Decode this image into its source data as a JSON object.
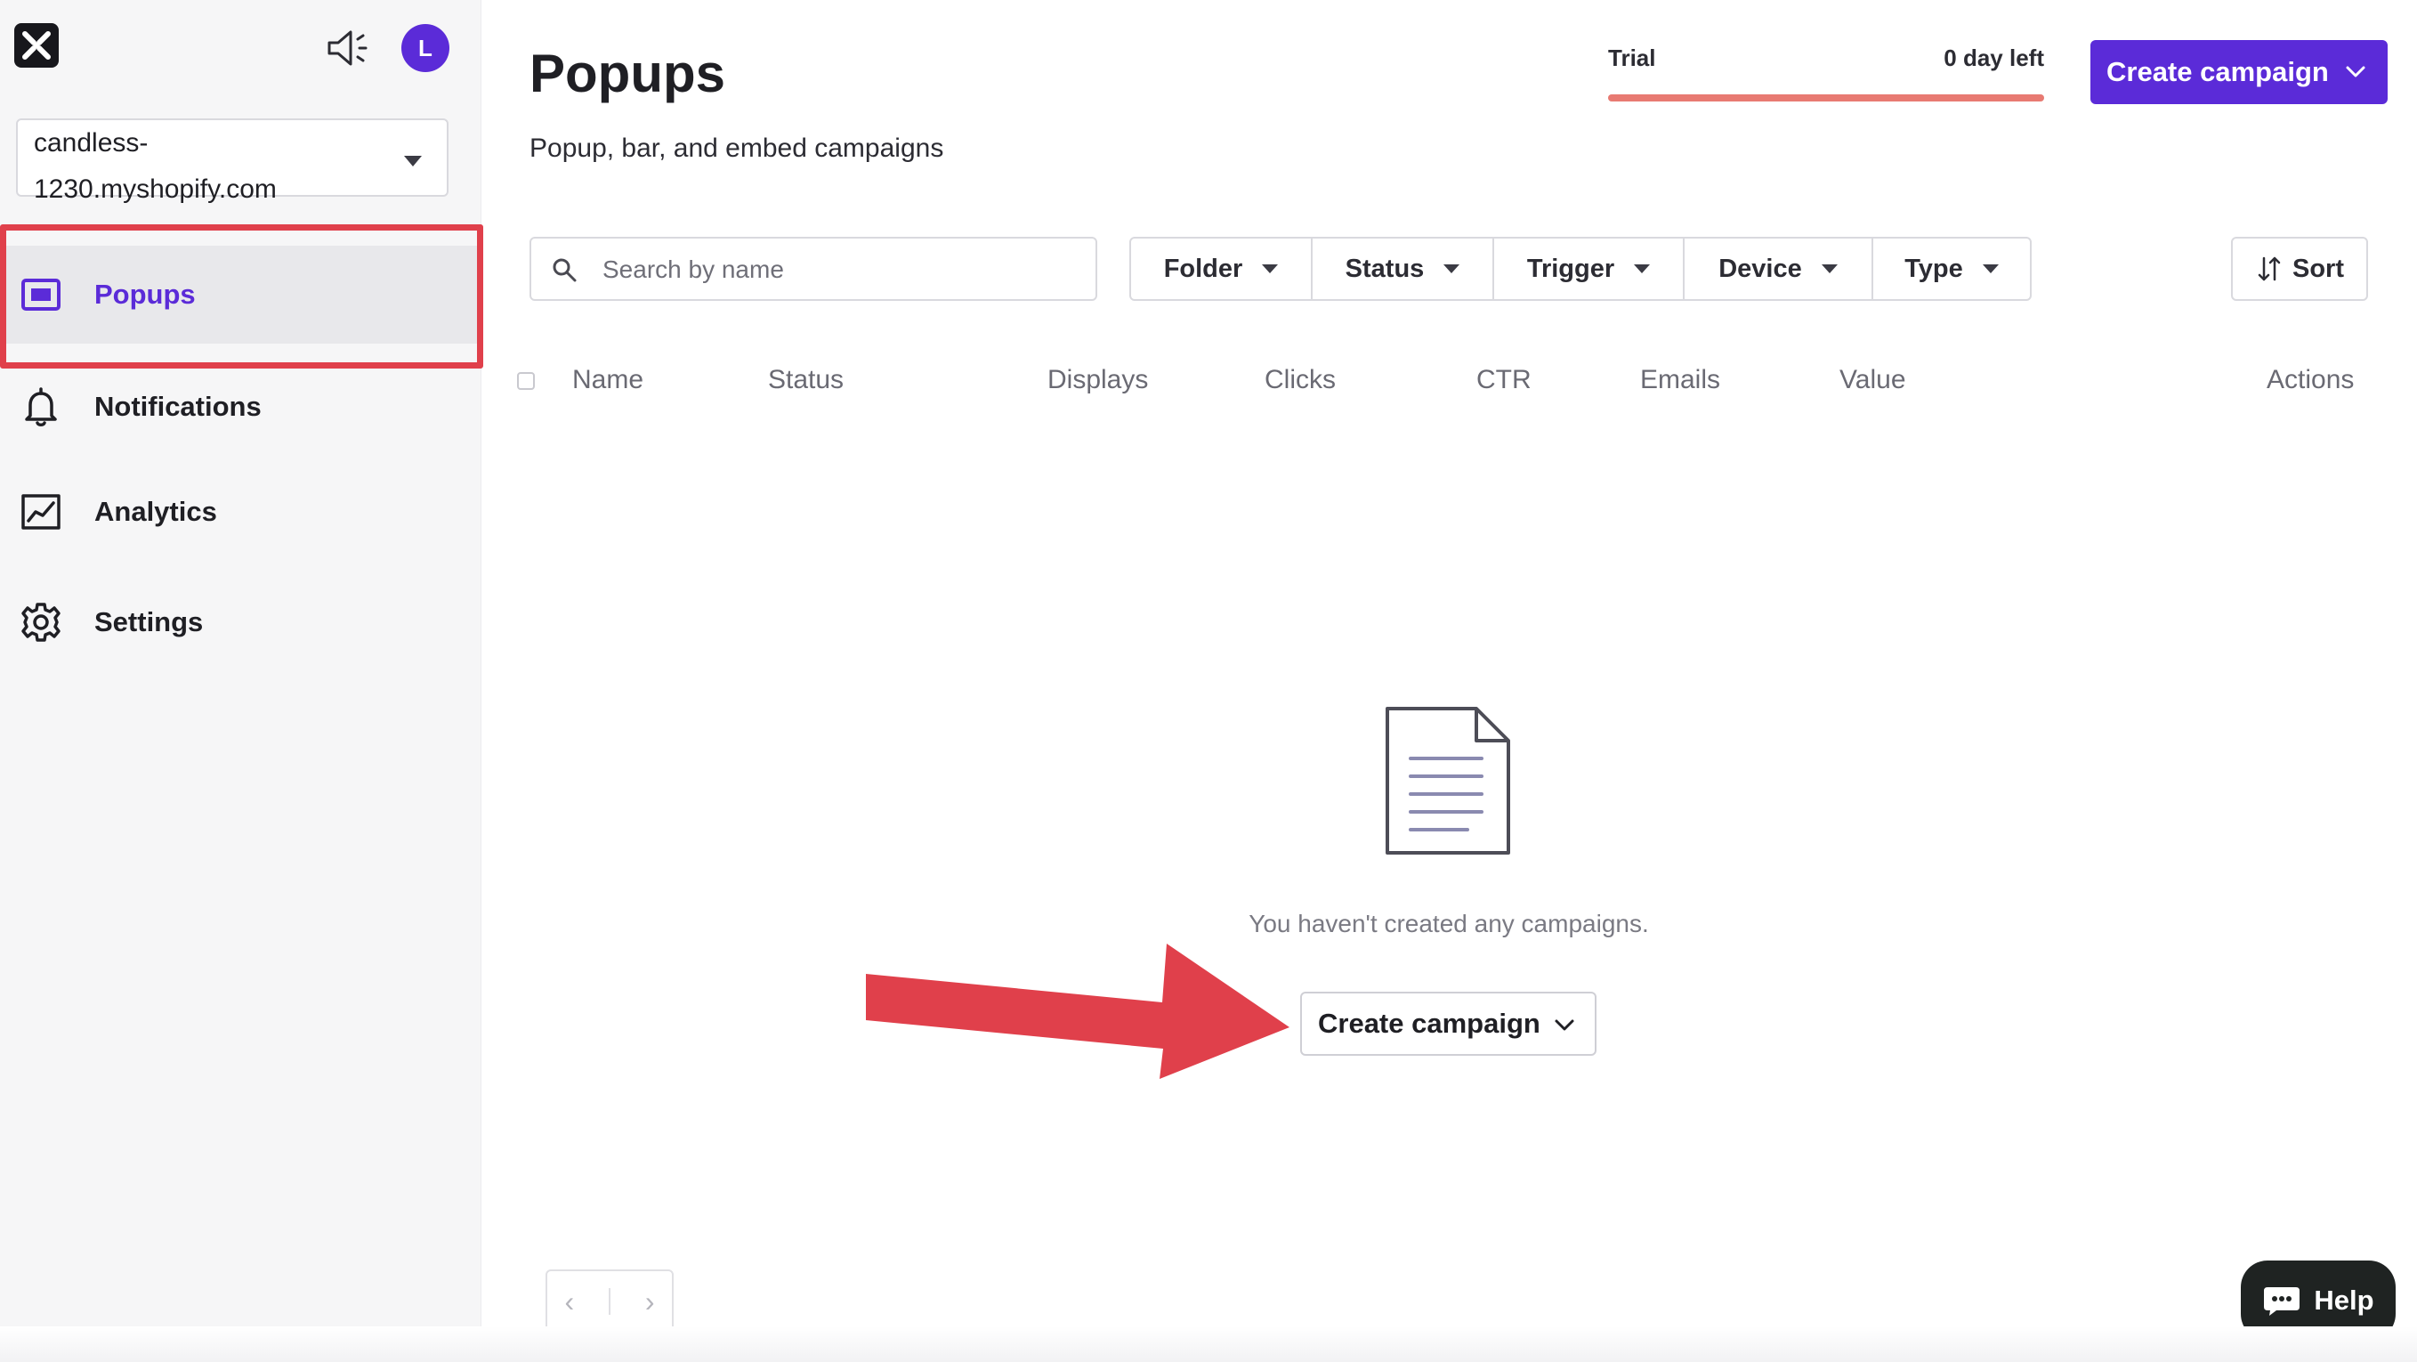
{
  "sidebar": {
    "store": "candless-1230.myshopify.com",
    "avatar_initial": "L",
    "items": [
      {
        "label": "Popups",
        "icon": "popup-window-icon",
        "active": true
      },
      {
        "label": "Notifications",
        "icon": "bell-icon",
        "active": false
      },
      {
        "label": "Analytics",
        "icon": "line-chart-icon",
        "active": false
      },
      {
        "label": "Settings",
        "icon": "gear-icon",
        "active": false
      }
    ]
  },
  "header": {
    "title": "Popups",
    "subtitle": "Popup, bar, and embed campaigns",
    "trial_label": "Trial",
    "trial_days": "0 day left",
    "trial_progress": 1.0,
    "create_label": "Create campaign"
  },
  "toolbar": {
    "search_placeholder": "Search by name",
    "filters": [
      "Folder",
      "Status",
      "Trigger",
      "Device",
      "Type"
    ],
    "sort_label": "Sort"
  },
  "table": {
    "columns": [
      "Name",
      "Status",
      "Displays",
      "Clicks",
      "CTR",
      "Emails",
      "Value",
      "Actions"
    ]
  },
  "empty_state": {
    "message": "You haven't created any campaigns.",
    "create_label": "Create campaign"
  },
  "help": {
    "label": "Help"
  },
  "colors": {
    "accent": "#5b2bd8",
    "trial_bar": "#e87a72",
    "annotation": "#e0404b",
    "help_bg": "#1f2322"
  }
}
